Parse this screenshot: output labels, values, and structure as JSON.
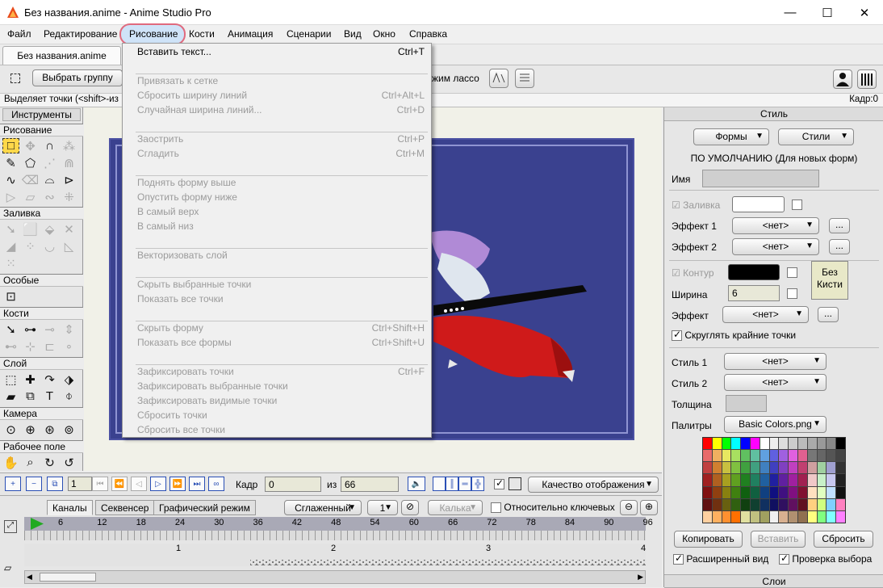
{
  "window": {
    "title": "Без названия.anime - Anime Studio Pro",
    "minimize": "—",
    "maximize": "☐",
    "close": "✕"
  },
  "menubar": [
    "Файл",
    "Редактирование",
    "Рисование",
    "Кости",
    "Анимация",
    "Сценарии",
    "Вид",
    "Окно",
    "Справка"
  ],
  "doc_tab": "Без названия.anime",
  "toolbar": {
    "select_group": "Выбрать группу",
    "lasso_mode": "жим лассо"
  },
  "hint": {
    "text": "Выделяет точки (<shift>-из",
    "frame": "Кадр:0"
  },
  "left_panel": {
    "header": "Инструменты",
    "sections": [
      "Рисование",
      "Заливка",
      "Особые",
      "Кости",
      "Слой",
      "Камера",
      "Рабочее поле"
    ]
  },
  "dropdown": {
    "items": [
      {
        "label": "Вставить текст...",
        "shortcut": "Ctrl+T",
        "enabled": true
      },
      {
        "label": "Привязать к сетке",
        "shortcut": "",
        "enabled": false
      },
      {
        "label": "Сбросить ширину линий",
        "shortcut": "Ctrl+Alt+L",
        "enabled": false
      },
      {
        "label": "Случайная ширина линий...",
        "shortcut": "Ctrl+D",
        "enabled": false
      },
      {
        "label": "Заострить",
        "shortcut": "Ctrl+P",
        "enabled": false
      },
      {
        "label": "Сгладить",
        "shortcut": "Ctrl+M",
        "enabled": false
      },
      {
        "label": "Поднять форму выше",
        "shortcut": "",
        "enabled": false
      },
      {
        "label": "Опустить форму ниже",
        "shortcut": "",
        "enabled": false
      },
      {
        "label": "В самый верх",
        "shortcut": "",
        "enabled": false
      },
      {
        "label": "В самый низ",
        "shortcut": "",
        "enabled": false
      },
      {
        "label": "Векторизовать слой",
        "shortcut": "",
        "enabled": false
      },
      {
        "label": "Скрыть выбранные точки",
        "shortcut": "",
        "enabled": false
      },
      {
        "label": "Показать все точки",
        "shortcut": "",
        "enabled": false
      },
      {
        "label": "Скрыть форму",
        "shortcut": "Ctrl+Shift+H",
        "enabled": false
      },
      {
        "label": "Показать все формы",
        "shortcut": "Ctrl+Shift+U",
        "enabled": false
      },
      {
        "label": "Зафиксировать точки",
        "shortcut": "Ctrl+F",
        "enabled": false
      },
      {
        "label": "Зафиксировать выбранные точки",
        "shortcut": "",
        "enabled": false
      },
      {
        "label": "Зафиксировать видимые точки",
        "shortcut": "",
        "enabled": false
      },
      {
        "label": "Сбросить точки",
        "shortcut": "",
        "enabled": false
      },
      {
        "label": "Сбросить все точки",
        "shortcut": "",
        "enabled": false
      }
    ]
  },
  "style_panel": {
    "header": "Стиль",
    "forms_btn": "Формы",
    "styles_btn": "Стили",
    "default_label": "ПО УМОЛЧАНИЮ (Для новых форм)",
    "name_label": "Имя",
    "fill_label": "Заливка",
    "effect1_label": "Эффект 1",
    "effect2_label": "Эффект 2",
    "none": "<нет>",
    "contour_label": "Контур",
    "width_label": "Ширина",
    "width_value": "6",
    "no_brush": "Без Кисти",
    "effect_label": "Эффект",
    "round_caps": "Скруглять крайние точки",
    "style1_label": "Стиль 1",
    "style2_label": "Стиль 2",
    "thickness_label": "Толщина",
    "palettes_label": "Палитры",
    "palette_value": "Basic Colors.png",
    "copy_btn": "Копировать",
    "paste_btn": "Вставить",
    "reset_btn": "Сбросить",
    "extended_view": "Расширенный вид",
    "check_selection": "Проверка выбора",
    "layers_header": "Слои",
    "ellipsis": "..."
  },
  "playback": {
    "frame_field_value": "1",
    "frame_label": "Кадр",
    "frame_value": "0",
    "of_label": "из",
    "total": "66",
    "quality": "Качество отображения"
  },
  "timeline": {
    "tabs": [
      "Каналы",
      "Секвенсер",
      "Графический режим"
    ],
    "smooth": "Сглаженный",
    "num": "1",
    "brush": "Калька",
    "relative": "Относительно ключевых",
    "ruler_ticks": [
      "6",
      "12",
      "18",
      "24",
      "30",
      "36",
      "42",
      "48",
      "54",
      "60",
      "66",
      "72",
      "78",
      "84",
      "90",
      "96"
    ],
    "lower_ticks": [
      "1",
      "2",
      "3",
      "4"
    ]
  },
  "palette_colors": [
    "#ff0000",
    "#ffff00",
    "#00ff00",
    "#00ffff",
    "#0000ff",
    "#ff00ff",
    "#ffffff",
    "#eeeeee",
    "#dddddd",
    "#cccccc",
    "#bbbbbb",
    "#aaaaaa",
    "#999999",
    "#888888",
    "#000000",
    "#e86a6a",
    "#f0b060",
    "#e8e860",
    "#a8e060",
    "#60c060",
    "#60c0a0",
    "#60a0e0",
    "#6060e0",
    "#a060e0",
    "#e060e0",
    "#e06090",
    "#777777",
    "#666666",
    "#555555",
    "#444444",
    "#c04040",
    "#d08030",
    "#c8c040",
    "#80c040",
    "#40a040",
    "#40a080",
    "#4080c0",
    "#4040c0",
    "#8040c0",
    "#c040c0",
    "#c04070",
    "#d0a0a0",
    "#a0d0a0",
    "#a0a0d0",
    "#333333",
    "#a02020",
    "#b06020",
    "#a8a020",
    "#60a020",
    "#208020",
    "#208060",
    "#2060a0",
    "#2020a0",
    "#6020a0",
    "#a020a0",
    "#a02050",
    "#f0c8c8",
    "#c8f0c8",
    "#c8c8f0",
    "#222222",
    "#801010",
    "#904010",
    "#888010",
    "#408010",
    "#106010",
    "#106040",
    "#104080",
    "#101080",
    "#401080",
    "#801080",
    "#801030",
    "#ffe0c0",
    "#e0ffc0",
    "#c0e0ff",
    "#111111",
    "#601010",
    "#703010",
    "#686010",
    "#306010",
    "#104010",
    "#104030",
    "#103060",
    "#101060",
    "#301060",
    "#601060",
    "#601020",
    "#ffd080",
    "#d0ff80",
    "#80d0ff",
    "#ff80c0",
    "#ffd0a0",
    "#ffb060",
    "#ff9030",
    "#ff7000",
    "#e0e0a0",
    "#c0c080",
    "#a0a060",
    "#f0f0f0",
    "#d8b090",
    "#b09070",
    "#907050",
    "#ffff80",
    "#80ff80",
    "#80ffff",
    "#ff80ff"
  ]
}
